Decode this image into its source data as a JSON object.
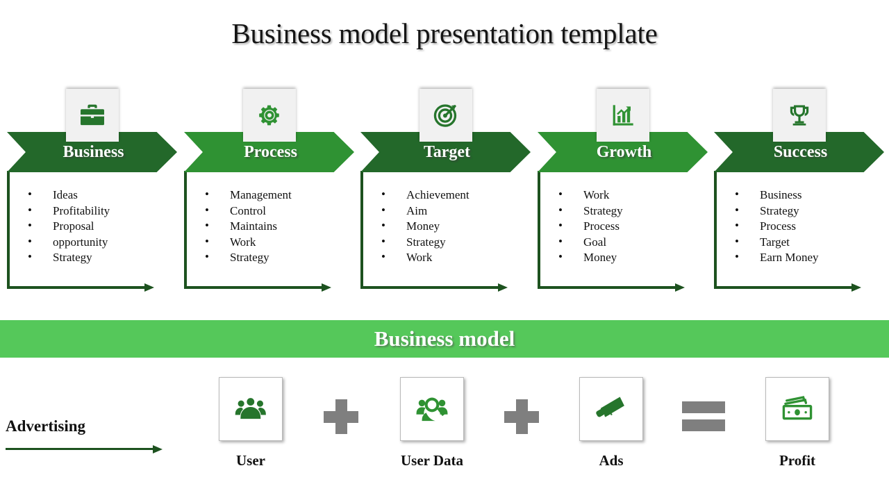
{
  "slide": {
    "title": "Business model presentation template",
    "banner_label": "Business model"
  },
  "theme": {
    "green_dark": "#23682a",
    "green_light": "#2f9233",
    "green_banner": "#55c85a",
    "green_rail": "#1d521f",
    "gray_operator": "#7f7f7f",
    "icon_plate_bg": "#f1f1f1",
    "text_dark": "#111111",
    "text_light": "#ffffff"
  },
  "columns": [
    {
      "label": "Business",
      "icon": "briefcase-icon",
      "tone": "dark",
      "bullets": [
        "Ideas",
        "Profitability",
        "Proposal",
        "opportunity",
        "Strategy"
      ]
    },
    {
      "label": "Process",
      "icon": "gear-icon",
      "tone": "light",
      "bullets": [
        "Management",
        "Control",
        "Maintains",
        "Work",
        "Strategy"
      ]
    },
    {
      "label": "Target",
      "icon": "target-icon",
      "tone": "dark",
      "bullets": [
        "Achievement",
        "Aim",
        "Money",
        "Strategy",
        "Work"
      ]
    },
    {
      "label": "Growth",
      "icon": "bar-chart-growth-icon",
      "tone": "light",
      "bullets": [
        "Work",
        "Strategy",
        "Process",
        "Goal",
        "Money"
      ]
    },
    {
      "label": "Success",
      "icon": "trophy-icon",
      "tone": "dark",
      "bullets": [
        "Business",
        "Strategy",
        "Process",
        "Target",
        "Earn Money"
      ]
    }
  ],
  "equation": {
    "advertising_label": "Advertising",
    "items": [
      {
        "label": "User",
        "icon": "users-group-icon"
      },
      {
        "label": "User Data",
        "icon": "user-search-icon"
      },
      {
        "label": "Ads",
        "icon": "megaphone-icon"
      },
      {
        "label": "Profit",
        "icon": "cash-money-icon"
      }
    ],
    "operators": [
      "plus",
      "plus",
      "equals"
    ]
  }
}
